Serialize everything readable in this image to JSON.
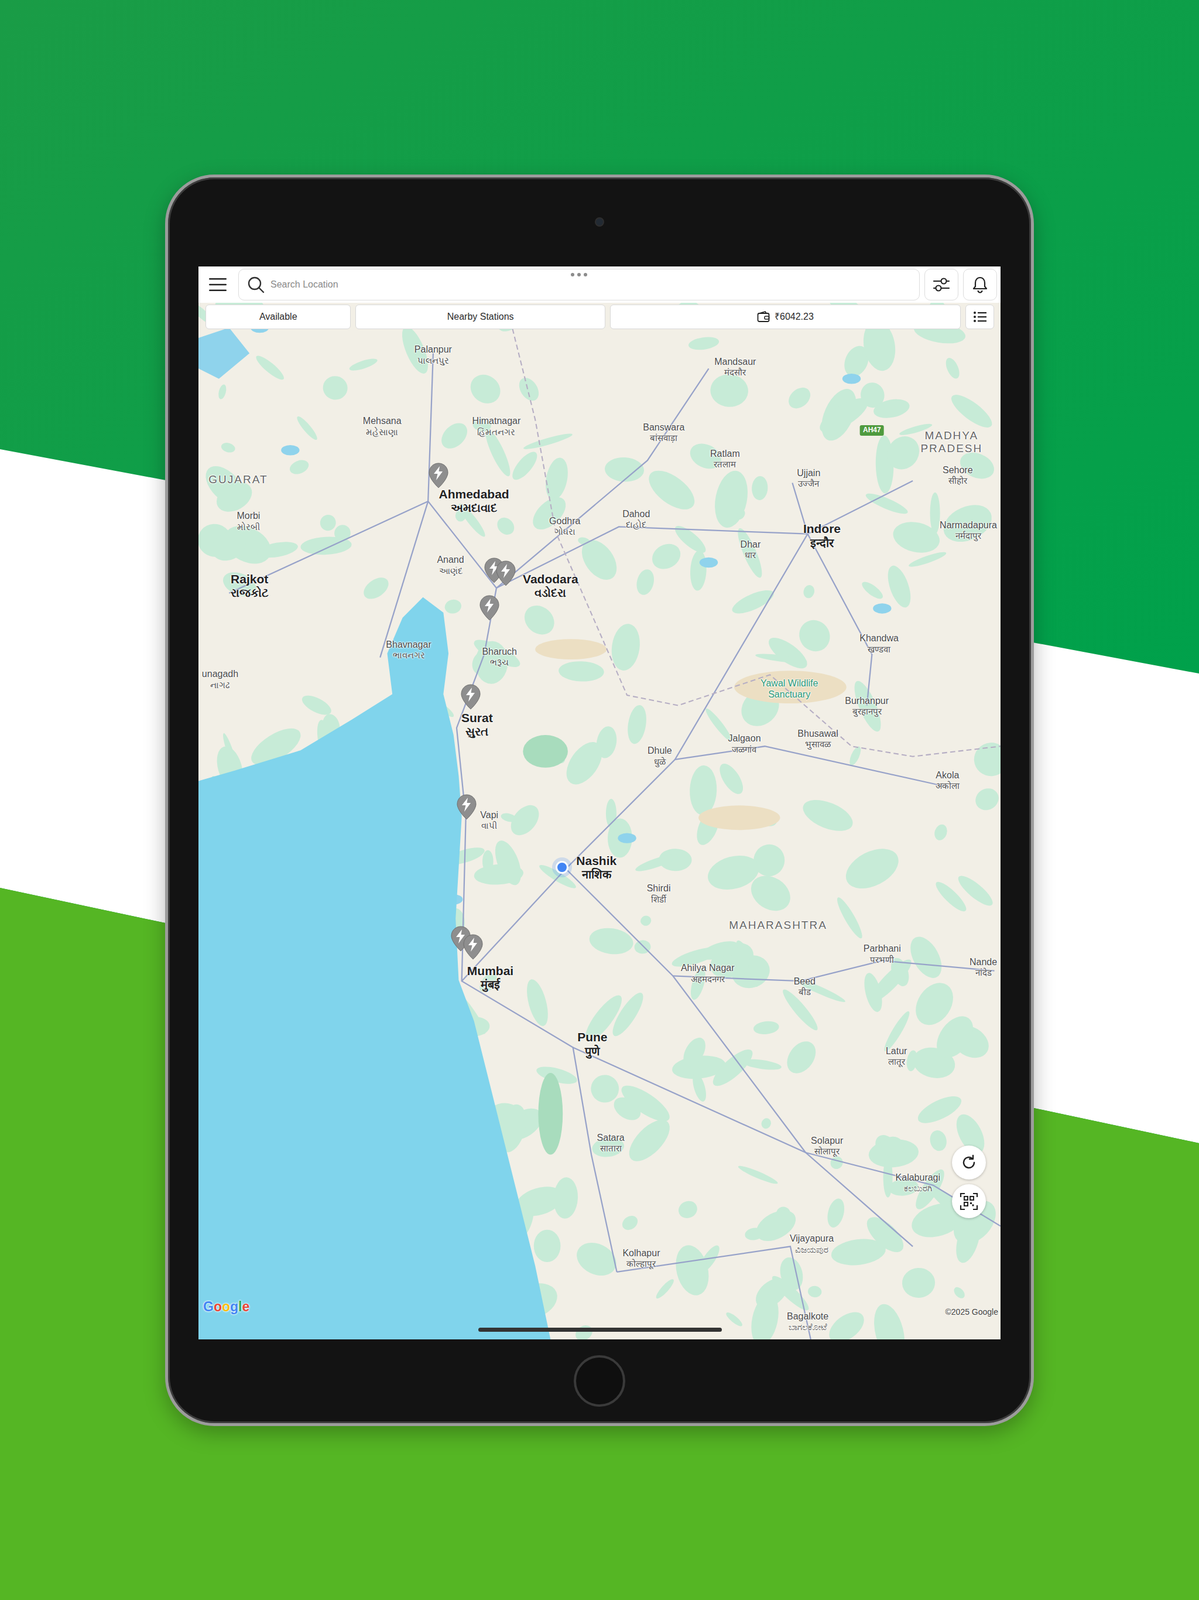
{
  "search": {
    "placeholder": "Search Location"
  },
  "filters": [
    {
      "label": "Available",
      "selected": false
    },
    {
      "label": "Nearby Stations",
      "selected": false
    }
  ],
  "wallet": {
    "balance": "₹6042.23"
  },
  "map": {
    "labels": [
      {
        "kind": "city",
        "name": "Palanpur",
        "local": "પાલનપુર"
      },
      {
        "kind": "city",
        "name": "Mandsaur",
        "local": "मंदसौर"
      },
      {
        "kind": "city",
        "name": "Mehsana",
        "local": "મહેસાણા"
      },
      {
        "kind": "city",
        "name": "Himatnagar",
        "local": "હિંમતનગર"
      },
      {
        "kind": "city",
        "name": "Banswara",
        "local": "बांसवाड़ा"
      },
      {
        "kind": "badge",
        "name": "AH47"
      },
      {
        "kind": "region",
        "name": "MADHYA\nPRADESH"
      },
      {
        "kind": "city",
        "name": "Ratlam",
        "local": "रतलाम"
      },
      {
        "kind": "city",
        "name": "Ujjain",
        "local": "उज्जैन"
      },
      {
        "kind": "city",
        "name": "Sehore",
        "local": "सीहोर"
      },
      {
        "kind": "region",
        "name": "GUJARAT"
      },
      {
        "kind": "major",
        "name": "Ahmedabad",
        "local": "અમદાવાદ"
      },
      {
        "kind": "city",
        "name": "Morbi",
        "local": "મોરબી"
      },
      {
        "kind": "city",
        "name": "Dahod",
        "local": "દાહોદ"
      },
      {
        "kind": "city",
        "name": "Godhra",
        "local": "ગોધરા"
      },
      {
        "kind": "major",
        "name": "Indore",
        "local": "इन्दौर"
      },
      {
        "kind": "city",
        "name": "Narmadapura",
        "local": "नर्मदापुर"
      },
      {
        "kind": "city",
        "name": "Dhar",
        "local": "धार"
      },
      {
        "kind": "city",
        "name": "Anand",
        "local": "આણંદ"
      },
      {
        "kind": "major",
        "name": "Vadodara",
        "local": "વડોદરા"
      },
      {
        "kind": "major",
        "name": "Rajkot",
        "local": "રાજકોટ"
      },
      {
        "kind": "city",
        "name": "Bhavnagar",
        "local": "ભાવનગર"
      },
      {
        "kind": "city",
        "name": "Bharuch",
        "local": "ભરૂચ"
      },
      {
        "kind": "city",
        "name": "Khandwa",
        "local": "खण्डवा"
      },
      {
        "kind": "city",
        "name": "unagadh",
        "local": "નાગઢ"
      },
      {
        "kind": "park",
        "name": "Yawal Wildlife\nSanctuary"
      },
      {
        "kind": "city",
        "name": "Burhanpur",
        "local": "बुरहानपुर"
      },
      {
        "kind": "major",
        "name": "Surat",
        "local": "સુરત"
      },
      {
        "kind": "city",
        "name": "Jalgaon",
        "local": "जळगांव"
      },
      {
        "kind": "city",
        "name": "Bhusawal",
        "local": "भुसावळ"
      },
      {
        "kind": "city",
        "name": "Dhule",
        "local": "धुळे"
      },
      {
        "kind": "city",
        "name": "Akola",
        "local": "अकोला"
      },
      {
        "kind": "city",
        "name": "Vapi",
        "local": "વાપી"
      },
      {
        "kind": "major",
        "name": "Nashik",
        "local": "नाशिक"
      },
      {
        "kind": "city",
        "name": "Shirdi",
        "local": "शिर्डी"
      },
      {
        "kind": "region",
        "name": "MAHARASHTRA"
      },
      {
        "kind": "city",
        "name": "Parbhani",
        "local": "परभणी"
      },
      {
        "kind": "city",
        "name": "Nande",
        "local": "नांदेड"
      },
      {
        "kind": "major",
        "name": "Mumbai",
        "local": "मुंबई"
      },
      {
        "kind": "city",
        "name": "Ahilya Nagar",
        "local": "अहमदनगर"
      },
      {
        "kind": "city",
        "name": "Beed",
        "local": "बीड"
      },
      {
        "kind": "major",
        "name": "Pune",
        "local": "पुणे"
      },
      {
        "kind": "city",
        "name": "Latur",
        "local": "लातूर"
      },
      {
        "kind": "city",
        "name": "Satara",
        "local": "सातारा"
      },
      {
        "kind": "city",
        "name": "Solapur",
        "local": "सोलापूर"
      },
      {
        "kind": "city",
        "name": "Kalaburagi",
        "local": "ಕಲಬುರಗಿ"
      },
      {
        "kind": "city",
        "name": "Vijayapura",
        "local": "ವಿಜಯಪುರ"
      },
      {
        "kind": "city",
        "name": "Kolhapur",
        "local": "कोल्हापूर"
      },
      {
        "kind": "city",
        "name": "Bagalkote",
        "local": "ಬಾಗಲಕೋಟೆ"
      }
    ],
    "stations": [
      {
        "available": false
      },
      {
        "available": false
      },
      {
        "available": false
      },
      {
        "available": false
      },
      {
        "available": false
      },
      {
        "available": false
      },
      {
        "available": false
      },
      {
        "available": false
      }
    ],
    "user_location": {
      "shown": true
    },
    "logo": "Google",
    "attribution": "©2025 Google"
  }
}
